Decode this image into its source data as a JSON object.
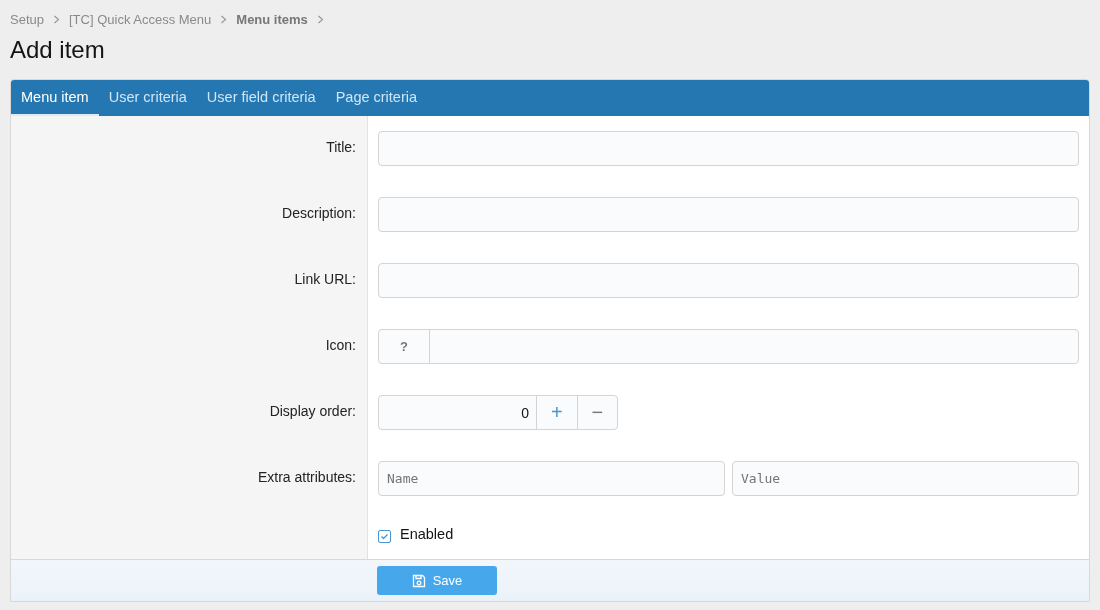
{
  "breadcrumb": [
    {
      "label": "Setup",
      "current": false
    },
    {
      "label": "[TC] Quick Access Menu",
      "current": false
    },
    {
      "label": "Menu items",
      "current": true
    }
  ],
  "title": "Add item",
  "tabs": [
    {
      "label": "Menu item",
      "selected": true
    },
    {
      "label": "User criteria",
      "selected": false
    },
    {
      "label": "User field criteria",
      "selected": false
    },
    {
      "label": "Page criteria",
      "selected": false
    }
  ],
  "rows": [
    {
      "kind": "text",
      "label": "Title:"
    },
    {
      "kind": "text",
      "label": "Description:"
    },
    {
      "kind": "text",
      "label": "Link URL:"
    },
    {
      "kind": "icon",
      "label": "Icon:",
      "button": "?"
    },
    {
      "kind": "number",
      "label": "Display order:",
      "value": "0",
      "plus": "+",
      "minus": "−"
    },
    {
      "kind": "pair",
      "label": "Extra attributes:",
      "placeholders": [
        "Name",
        "Value"
      ]
    },
    {
      "kind": "checkbox",
      "text": "Enabled",
      "checked": true
    }
  ],
  "save_button": "Save"
}
